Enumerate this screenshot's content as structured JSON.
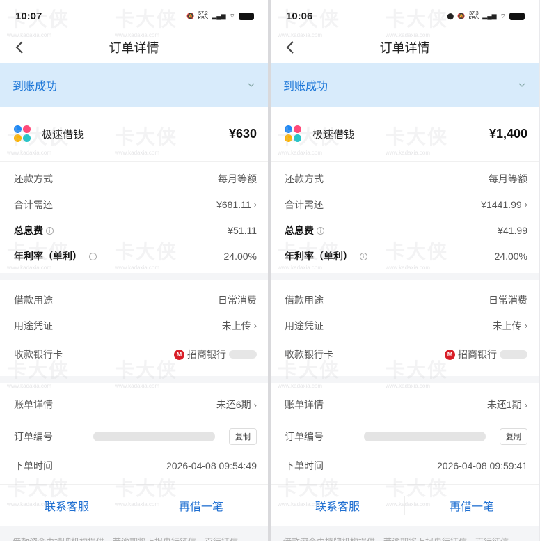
{
  "screens": [
    {
      "status_time": "10:07",
      "net_speed": "57.2\nKB/s",
      "nav_title": "订单详情",
      "order_status": "到账成功",
      "product_name": "极速借钱",
      "amount": "¥630",
      "repay_method_label": "还款方式",
      "repay_method_value": "每月等额",
      "total_due_label": "合计需还",
      "total_due_value": "¥681.11",
      "total_interest_label": "总息费",
      "total_interest_value": "¥51.11",
      "apr_label": "年利率（单利）",
      "apr_value": "24.00%",
      "purpose_label": "借款用途",
      "purpose_value": "日常消费",
      "voucher_label": "用途凭证",
      "voucher_value": "未上传",
      "bank_label": "收款银行卡",
      "bank_name": "招商银行",
      "bill_label": "账单详情",
      "bill_value": "未还6期",
      "order_no_label": "订单编号",
      "copy_label": "复制",
      "order_time_label": "下单时间",
      "order_time_value": "2026-04-08 09:54:49",
      "contact_label": "联系客服",
      "reborrow_label": "再借一笔",
      "footer_text": "借款资金由持牌机构提供，若逾期将上报央行征信、百行征信"
    },
    {
      "status_time": "10:06",
      "net_speed": "37.3\nKB/s",
      "nav_title": "订单详情",
      "order_status": "到账成功",
      "product_name": "极速借钱",
      "amount": "¥1,400",
      "repay_method_label": "还款方式",
      "repay_method_value": "每月等额",
      "total_due_label": "合计需还",
      "total_due_value": "¥1441.99",
      "total_interest_label": "总息费",
      "total_interest_value": "¥41.99",
      "apr_label": "年利率（单利）",
      "apr_value": "24.00%",
      "purpose_label": "借款用途",
      "purpose_value": "日常消费",
      "voucher_label": "用途凭证",
      "voucher_value": "未上传",
      "bank_label": "收款银行卡",
      "bank_name": "招商银行",
      "bill_label": "账单详情",
      "bill_value": "未还1期",
      "order_no_label": "订单编号",
      "copy_label": "复制",
      "order_time_label": "下单时间",
      "order_time_value": "2026-04-08 09:59:41",
      "contact_label": "联系客服",
      "reborrow_label": "再借一笔",
      "footer_text": "借款资金由持牌机构提供，若逾期将上报央行征信、百行征信"
    }
  ],
  "watermark": {
    "text": "卡大侠",
    "url": "www.kadaxia.com"
  },
  "colors": {
    "accent": "#1f78d8",
    "banner_bg": "#d8ebfb",
    "bank_red": "#d81e27"
  },
  "icons": [
    "back-icon",
    "chevron-down-icon",
    "info-icon",
    "arrow-right-icon",
    "product-logo-icon",
    "cmb-bank-icon"
  ]
}
